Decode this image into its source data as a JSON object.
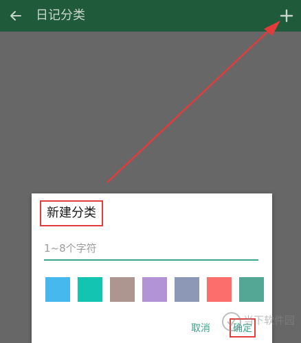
{
  "toolbar": {
    "title": "日记分类",
    "back_icon": "arrow-left-icon",
    "add_icon": "plus-icon",
    "background": "#1f5b3a"
  },
  "dialog": {
    "title": "新建分类",
    "input_placeholder": "1~8个字符",
    "input_value": "",
    "swatches": [
      "#46b8ee",
      "#12c4b1",
      "#ad9590",
      "#b293d6",
      "#8c98b6",
      "#fb6e6b",
      "#55a795"
    ],
    "cancel_label": "取消",
    "confirm_label": "确定",
    "accent": "#3aa58a"
  },
  "annotation": {
    "highlight_color": "#e23b3b"
  },
  "watermark": {
    "text": "当下软件园"
  }
}
